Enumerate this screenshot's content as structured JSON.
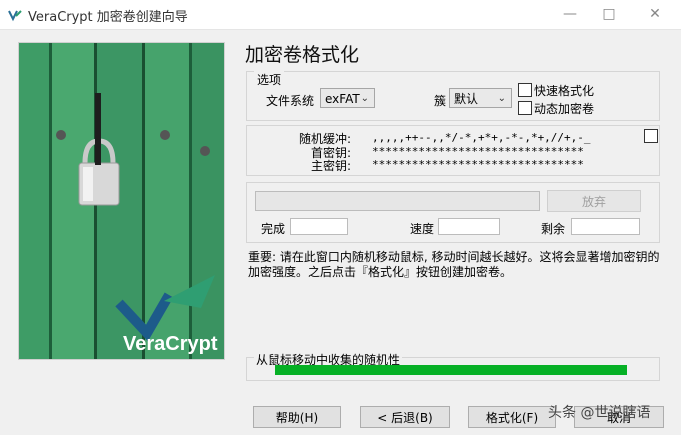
{
  "window": {
    "title": "VeraCrypt 加密卷创建向导",
    "controls": [
      "—",
      "□",
      "✕"
    ]
  },
  "side_image": {
    "brand": "VeraCrypt"
  },
  "page": {
    "heading": "加密卷格式化"
  },
  "options": {
    "legend": "选项",
    "filesystem_label": "文件系统",
    "filesystem_value": "exFAT",
    "cluster_label": "簇",
    "cluster_value": "默认",
    "quick_format_label": "快速格式化",
    "dynamic_label": "动态加密卷"
  },
  "keys": {
    "random_pool_label": "随机缓冲:",
    "random_pool_value": ",,,,,++--,,*/-*,+*+,-*-,*+,//+,-_",
    "header_key_label": "首密钥:",
    "header_key_value": "********************************",
    "master_key_label": "主密钥:",
    "master_key_value": "********************************"
  },
  "progress": {
    "abort_label": "放弃",
    "done_label": "完成",
    "speed_label": "速度",
    "remaining_label": "剩余"
  },
  "info_text": "重要: 请在此窗口内随机移动鼠标, 移动时间越长越好。这将会显著增加密钥的加密强度。之后点击『格式化』按钮创建加密卷。",
  "randomness": {
    "label": "从鼠标移动中收集的随机性",
    "level": 1.0
  },
  "buttons": {
    "help": "帮助(H)",
    "back": "< 后退(B)",
    "format": "格式化(F)",
    "cancel": "取消"
  },
  "watermark": "头条 @世说瞎语",
  "colors": {
    "progress_green": "#06b025",
    "wall_green": "#2f8a5a"
  }
}
